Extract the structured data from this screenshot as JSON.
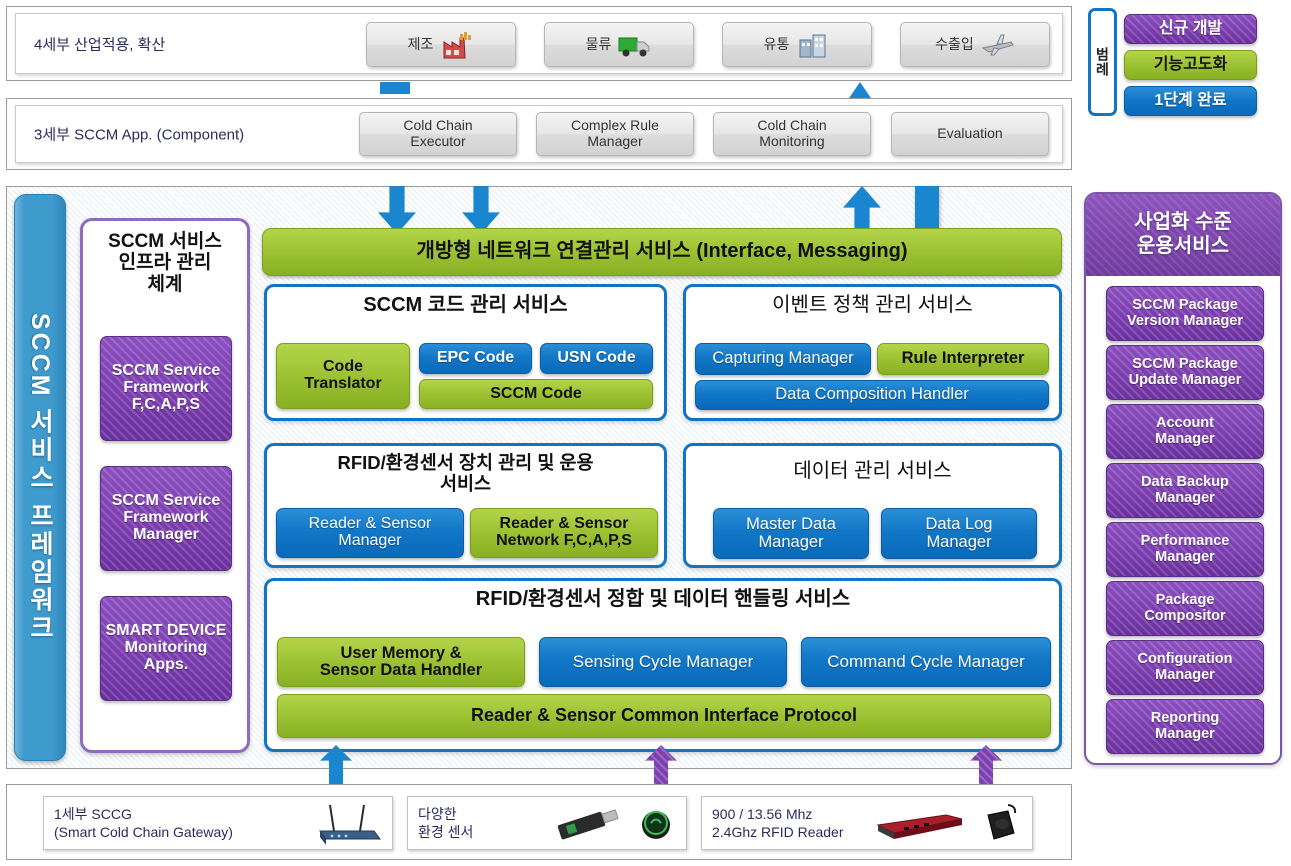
{
  "colors": {
    "blue": "#1275c4",
    "green": "#9cc234",
    "purple": "#7b3fb0",
    "spine_blue": "#3f9bce",
    "panel_purple_border": "#8e6bbd"
  },
  "tier4": {
    "label": "4세부 산업적용, 확산",
    "items": [
      {
        "label": "제조",
        "icon": "factory-icon"
      },
      {
        "label": "물류",
        "icon": "truck-icon"
      },
      {
        "label": "유통",
        "icon": "store-icon"
      },
      {
        "label": "수출입",
        "icon": "airplane-icon"
      }
    ]
  },
  "tier3": {
    "label": "3세부 SCCM App. (Component)",
    "items": [
      {
        "label": "Cold Chain\nExecutor"
      },
      {
        "label": "Complex Rule\nManager"
      },
      {
        "label": "Cold Chain\nMonitoring"
      },
      {
        "label": "Evaluation"
      }
    ]
  },
  "legend": {
    "tab_label": "범례",
    "items": [
      {
        "label": "신규 개발",
        "style": "purple"
      },
      {
        "label": "기능고도화",
        "style": "green"
      },
      {
        "label": "1단계 완료",
        "style": "blue"
      }
    ]
  },
  "framework": {
    "spine_label": "SCCM 서비스 프레임워크",
    "infra": {
      "title": "SCCM 서비스\n인프라 관리\n체계",
      "items": [
        {
          "label": "SCCM Service\nFramework\nF,C,A,P,S",
          "style": "purple"
        },
        {
          "label": "SCCM Service\nFramework\nManager",
          "style": "purple"
        },
        {
          "label": "SMART DEVICE\nMonitoring\nApps.",
          "style": "purple"
        }
      ]
    },
    "network_bar": {
      "label": "개방형 네트워크 연결관리 서비스 (Interface,  Messaging)",
      "style": "green"
    },
    "code_service": {
      "title": "SCCM 코드 관리 서비스",
      "items": [
        {
          "label": "Code\nTranslator",
          "style": "green"
        },
        {
          "label": "EPC Code",
          "style": "blue"
        },
        {
          "label": "USN Code",
          "style": "blue"
        },
        {
          "label": "SCCM Code",
          "style": "green"
        }
      ]
    },
    "event_service": {
      "title": "이벤트 정책 관리 서비스",
      "items": [
        {
          "label": "Capturing Manager",
          "style": "blue"
        },
        {
          "label": "Rule Interpreter",
          "style": "green"
        },
        {
          "label": "Data Composition Handler",
          "style": "blue"
        }
      ]
    },
    "device_service": {
      "title": "RFID/환경센서 장치 관리 및 운용\n서비스",
      "items": [
        {
          "label": "Reader & Sensor\nManager",
          "style": "blue"
        },
        {
          "label": "Reader & Sensor\nNetwork F,C,A,P,S",
          "style": "green"
        }
      ]
    },
    "data_service": {
      "title": "데이터 관리 서비스",
      "items": [
        {
          "label": "Master Data\nManager",
          "style": "blue"
        },
        {
          "label": "Data Log\nManager",
          "style": "blue"
        }
      ]
    },
    "integration_service": {
      "title": "RFID/환경센서 정합 및 데이터 핸들링 서비스",
      "items": [
        {
          "label": "User Memory &\nSensor Data Handler",
          "style": "green"
        },
        {
          "label": "Sensing Cycle Manager",
          "style": "blue"
        },
        {
          "label": "Command Cycle Manager",
          "style": "blue"
        },
        {
          "label": "Reader & Sensor Common Interface Protocol",
          "style": "green"
        }
      ]
    }
  },
  "business": {
    "header": "사업화 수준\n운용서비스",
    "items": [
      {
        "label": "SCCM Package\nVersion Manager"
      },
      {
        "label": "SCCM Package\nUpdate Manager"
      },
      {
        "label": "Account\nManager"
      },
      {
        "label": "Data Backup\nManager"
      },
      {
        "label": "Performance\nManager"
      },
      {
        "label": "Package\nCompositor"
      },
      {
        "label": "Configuration\nManager"
      },
      {
        "label": "Reporting\nManager"
      }
    ]
  },
  "devices": [
    {
      "label": "1세부 SCCG\n(Smart Cold Chain Gateway)",
      "icons": [
        "router-icon"
      ]
    },
    {
      "label": "다양한\n환경 센서",
      "icons": [
        "usb-sensor-icon",
        "round-sensor-icon"
      ]
    },
    {
      "label": "900 / 13.56 Mhz\n2.4Ghz RFID Reader",
      "icons": [
        "rfid-reader-icon",
        "rfid-pad-icon"
      ]
    }
  ]
}
